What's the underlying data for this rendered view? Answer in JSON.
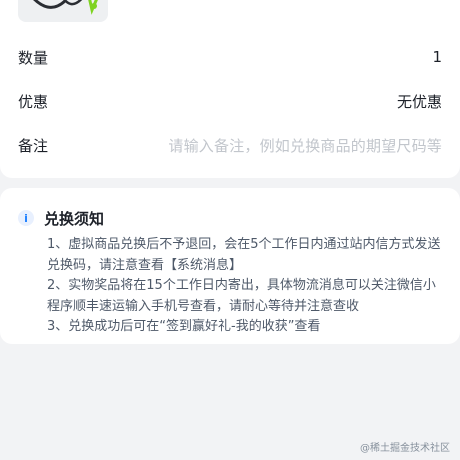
{
  "order": {
    "quantity_label": "数量",
    "quantity_value": "1",
    "discount_label": "优惠",
    "discount_value": "无优惠",
    "note_label": "备注",
    "note_placeholder": "请输入备注，例如兑换商品的期望尺码等"
  },
  "notice": {
    "icon": "info-icon",
    "title": "兑换须知",
    "items": [
      "1、虚拟商品兑换后不予退回，会在5个工作日内通过站内信方式发送兑换码，请注意查看【系统消息】",
      "2、实物奖品将在15个工作日内寄出，具体物流消息可以关注微信小程序顺丰速运输入手机号查看，请耐心等待并注意查收",
      "3、兑换成功后可在“签到赢好礼-我的收获”查看"
    ]
  },
  "watermark": "@稀土掘金技术社区",
  "colors": {
    "background": "#f2f3f5",
    "card": "#ffffff",
    "accent": "#1e80ff",
    "placeholder": "#c2c6cc",
    "text_secondary": "#4e5969"
  }
}
